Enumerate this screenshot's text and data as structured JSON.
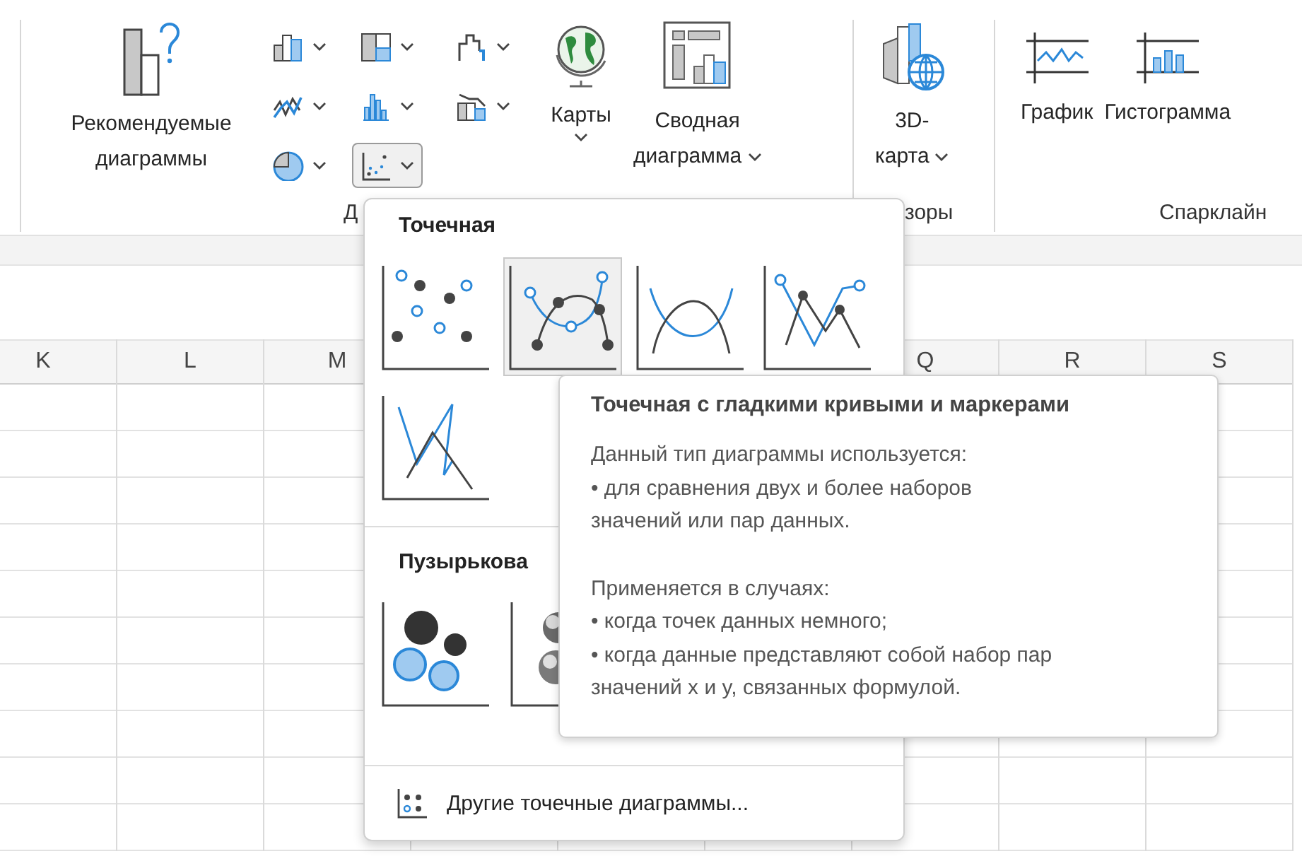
{
  "ribbon": {
    "groups": [
      {
        "kind": "charts",
        "label": "Д",
        "recommended": {
          "label": "Рекомендуемые диаграммы"
        },
        "chart_types": [
          {
            "kind": "column",
            "selected": false
          },
          {
            "kind": "hierarchy",
            "selected": false
          },
          {
            "kind": "waterfall",
            "selected": false
          },
          {
            "kind": "line",
            "selected": false
          },
          {
            "kind": "histogram",
            "selected": false
          },
          {
            "kind": "combo",
            "selected": false
          },
          {
            "kind": "pie",
            "selected": false
          },
          {
            "kind": "scatter",
            "selected": true
          }
        ],
        "maps": {
          "label": "Карты"
        },
        "pivot": {
          "label": "Сводная диаграмма"
        }
      },
      {
        "kind": "tours",
        "label": "зоры",
        "map3d": {
          "label": "3D-карта"
        }
      },
      {
        "kind": "sparklines",
        "label": "Спарклайн",
        "items": [
          {
            "kind": "line",
            "label": "График"
          },
          {
            "kind": "column",
            "label": "Гистограмма"
          }
        ]
      }
    ]
  },
  "sheet": {
    "columns_left": [
      "K",
      "L",
      "M"
    ],
    "columns_right": [
      "Q",
      "R",
      "S"
    ]
  },
  "dropdown": {
    "sections": [
      {
        "title": "Точечная",
        "items": [
          {
            "kind": "markers",
            "selected": false
          },
          {
            "kind": "smooth_markers",
            "selected": true
          },
          {
            "kind": "smooth_lines",
            "selected": false
          },
          {
            "kind": "straight_markers",
            "selected": false
          },
          {
            "kind": "straight_lines",
            "selected": false
          }
        ]
      },
      {
        "title": "Пузырькова",
        "items": [
          {
            "kind": "bubble",
            "selected": false
          },
          {
            "kind": "bubble_3d",
            "selected": false
          }
        ]
      }
    ],
    "footer": {
      "label": "Другие точечные диаграммы..."
    }
  },
  "tooltip": {
    "title": "Точечная с гладкими кривыми и маркерами",
    "paragraphs": [
      [
        "Данный тип диаграммы используется:",
        "• для сравнения двух и более наборов",
        "значений или пар данных."
      ],
      [
        "Применяется в случаях:",
        "• когда точек данных немного;",
        "• когда данные представляют собой набор пар",
        "значений x и y, связанных формулой."
      ]
    ]
  }
}
